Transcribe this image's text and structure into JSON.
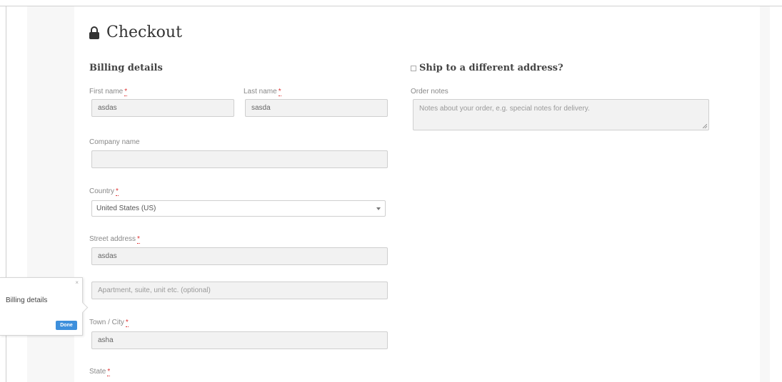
{
  "page": {
    "title": "Checkout"
  },
  "billing": {
    "heading": "Billing details",
    "first_name": {
      "label": "First name",
      "required": "*",
      "value": "asdas"
    },
    "last_name": {
      "label": "Last name",
      "required": "*",
      "value": "sasda"
    },
    "company": {
      "label": "Company name",
      "value": ""
    },
    "country": {
      "label": "Country",
      "required": "*",
      "value": "United States (US)"
    },
    "street": {
      "label": "Street address",
      "required": "*",
      "value": "asdas",
      "line2_placeholder": "Apartment, suite, unit etc. (optional)"
    },
    "city": {
      "label": "Town / City",
      "required": "*",
      "value": "asha"
    },
    "state": {
      "label": "State",
      "required": "*"
    }
  },
  "shipping": {
    "heading": "Ship to a different address?",
    "order_notes": {
      "label": "Order notes",
      "placeholder": "Notes about your order, e.g. special notes for delivery."
    }
  },
  "tooltip": {
    "title": "Billing details",
    "close": "×",
    "done_label": "Done"
  },
  "colors": {
    "accent": "#3d8fdc",
    "required": "#dd3333"
  }
}
